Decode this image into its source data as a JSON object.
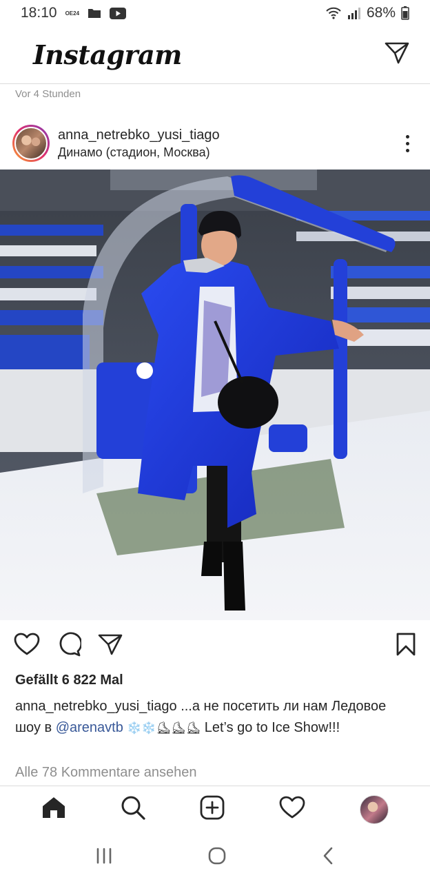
{
  "status_bar": {
    "time": "18:10",
    "carrier_badge": "OE24",
    "battery": "68%"
  },
  "header": {
    "logo": "Instagram",
    "dm_icon": "paper-plane-icon"
  },
  "post": {
    "time_ago": "Vor 4 Stunden",
    "username": "anna_netrebko_yusi_tiago",
    "location": "Динамо (стадион, Москва)",
    "likes": "Gefällt 6 822 Mal",
    "caption": {
      "username": "anna_netrebko_yusi_tiago",
      "text_1": " ...а не посетить ли нам Ледовое шоу в ",
      "mention": "@arenavtb",
      "emojis": " ❄️❄️⛸⛸⛸ ",
      "text_2": "Let’s go to Ice Show!!!"
    },
    "comments_link": "Alle 78 Kommentare ansehen"
  },
  "icons": {
    "like": "heart-icon",
    "comment": "comment-icon",
    "share": "paper-plane-icon",
    "save": "bookmark-icon",
    "home": "home-icon",
    "search": "search-icon",
    "create": "plus-square-icon",
    "activity": "heart-icon"
  },
  "colors": {
    "link": "#385898",
    "muted": "#8e8e8e",
    "coat_blue": "#1a36d6"
  }
}
